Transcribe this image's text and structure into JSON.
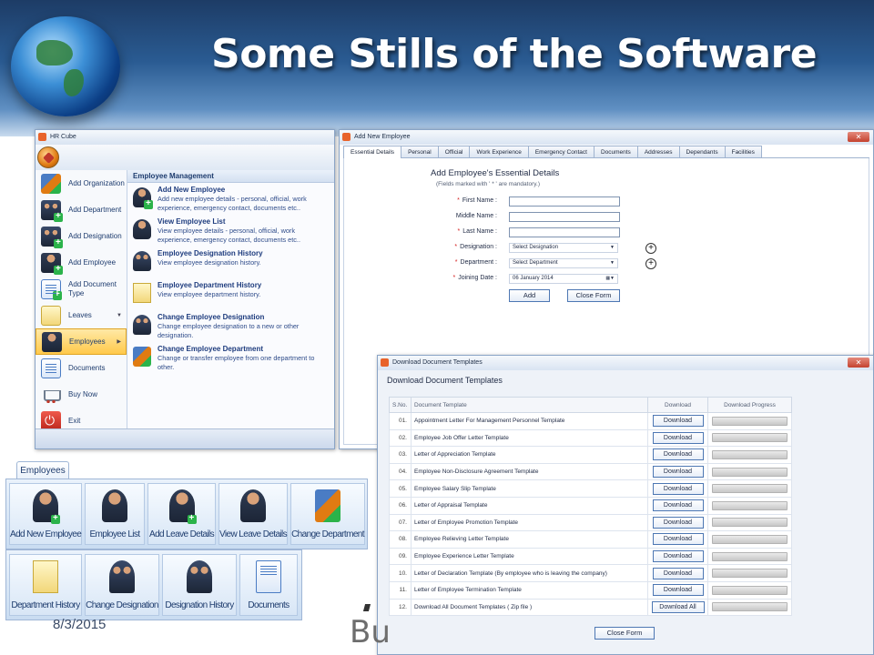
{
  "slide": {
    "title": "Some Stills of the Software",
    "date": "8/3/2015",
    "watermark": "Bu"
  },
  "hrcube": {
    "title": "HR Cube",
    "nav": [
      {
        "label": "Add Organization",
        "icon": "organization-icon"
      },
      {
        "label": "Add Department",
        "icon": "add-department-icon"
      },
      {
        "label": "Add Designation",
        "icon": "add-designation-icon"
      },
      {
        "label": "Add Employee",
        "icon": "add-employee-icon"
      },
      {
        "label": "Add Document Type",
        "icon": "document-type-icon"
      },
      {
        "label": "Leaves",
        "icon": "leaves-icon"
      },
      {
        "label": "Employees",
        "icon": "employees-icon"
      },
      {
        "label": "Documents",
        "icon": "documents-icon"
      },
      {
        "label": "Buy Now",
        "icon": "cart-icon"
      },
      {
        "label": "Exit",
        "icon": "power-icon"
      }
    ],
    "panel_title": "Employee Management",
    "items": [
      {
        "title": "Add New Employee",
        "desc": "Add new employee details - personal, official, work experience, emergency contact, documents etc.."
      },
      {
        "title": "View Employee List",
        "desc": "View employee details - personal, official, work experience, emergency contact, documents etc.."
      },
      {
        "title": "Employee Designation History",
        "desc": "View employee designation history."
      },
      {
        "title": "Employee Department History",
        "desc": "View employee department history."
      },
      {
        "title": "Change Employee Designation",
        "desc": "Change employee designation to a new or other designation."
      },
      {
        "title": "Change Employee Department",
        "desc": "Change or transfer employee from one department to other."
      }
    ]
  },
  "addemp": {
    "title": "Add New Employee",
    "tabs": [
      "Essential Details",
      "Personal",
      "Official",
      "Work Experience",
      "Emergency Contact",
      "Documents",
      "Addresses",
      "Dependants",
      "Facilities"
    ],
    "form_title": "Add Employee's Essential Details",
    "note": "(Fields marked with ' * ' are mandatory.)",
    "labels": {
      "first": "First Name :",
      "middle": "Middle Name :",
      "last": "Last Name :",
      "designation": "Designation :",
      "department": "Department :",
      "joining": "Joining Date :"
    },
    "designation_value": "Select Designation",
    "department_value": "Select Department",
    "joining_value": "06   January   2014",
    "add_label": "Add",
    "close_label": "Close Form"
  },
  "download": {
    "title": "Download Document Templates",
    "heading": "Download Document Templates",
    "columns": [
      "S.No.",
      "Document Template",
      "Download",
      "Download Progress"
    ],
    "rows": [
      {
        "sno": "01.",
        "name": "Appointment Letter For Management Personnel Template",
        "btn": "Download"
      },
      {
        "sno": "02.",
        "name": "Employee Job Offer Letter Template",
        "btn": "Download"
      },
      {
        "sno": "03.",
        "name": "Letter of Appreciation Template",
        "btn": "Download"
      },
      {
        "sno": "04.",
        "name": "Employee Non-Disclosure Agreement Template",
        "btn": "Download"
      },
      {
        "sno": "05.",
        "name": "Employee Salary Slip Template",
        "btn": "Download"
      },
      {
        "sno": "06.",
        "name": "Letter of Appraisal Template",
        "btn": "Download"
      },
      {
        "sno": "07.",
        "name": "Letter of Employee Promotion Template",
        "btn": "Download"
      },
      {
        "sno": "08.",
        "name": "Employee Relieving Letter Template",
        "btn": "Download"
      },
      {
        "sno": "09.",
        "name": "Employee Experience Letter Template",
        "btn": "Download"
      },
      {
        "sno": "10.",
        "name": "Letter of Declaration Template (By employee who is leaving the company)",
        "btn": "Download"
      },
      {
        "sno": "11.",
        "name": "Letter of Employee Termination Template",
        "btn": "Download"
      },
      {
        "sno": "12.",
        "name": "Download All Document Templates ( Zip file )",
        "btn": "Download All"
      }
    ],
    "progress_value": 0,
    "close_label": "Close Form"
  },
  "ribbon": {
    "tab_label": "Employees",
    "row1": [
      "Add New Employee",
      "Employee List",
      "Add Leave Details",
      "View Leave Details",
      "Change Department"
    ],
    "row2": [
      "Department History",
      "Change Designation",
      "Designation History",
      "Documents"
    ]
  }
}
